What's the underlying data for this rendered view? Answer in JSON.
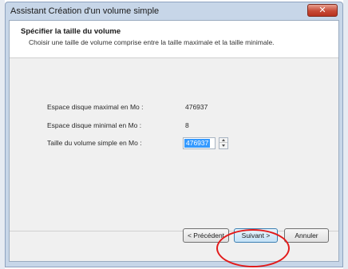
{
  "window": {
    "title": "Assistant Création d'un volume simple",
    "close_icon": "close-icon",
    "close_symbol": "✕"
  },
  "header": {
    "title": "Spécifier la taille du volume",
    "subtitle": "Choisir une taille de volume comprise entre la taille maximale et la taille minimale."
  },
  "fields": {
    "max_label": "Espace disque maximal en Mo :",
    "max_value": "476937",
    "min_label": "Espace disque minimal en Mo :",
    "min_value": "8",
    "size_label": "Taille du volume simple en Mo :",
    "size_value": "476937"
  },
  "buttons": {
    "previous": "< Précédent",
    "next": "Suivant >",
    "cancel": "Annuler"
  },
  "colors": {
    "annotation": "#e21b1b",
    "selection": "#3399ff",
    "close_button": "#c74a36"
  }
}
